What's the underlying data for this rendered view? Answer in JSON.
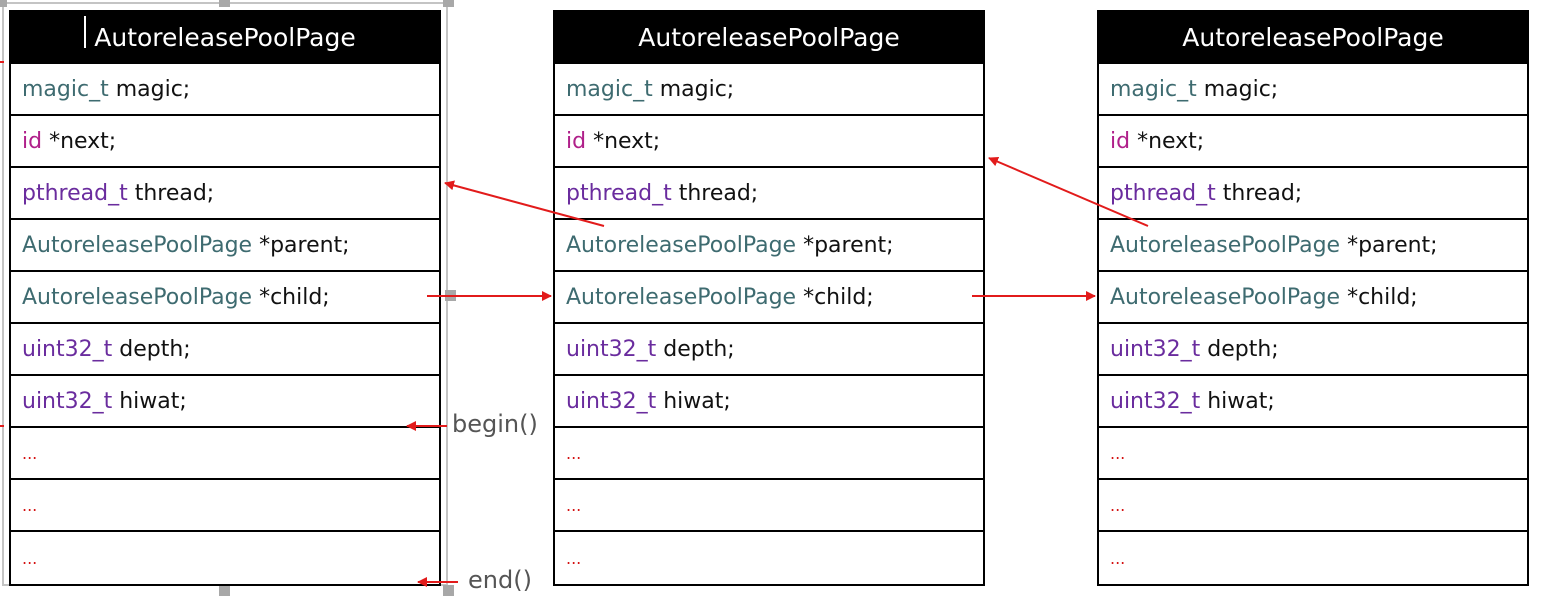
{
  "colors": {
    "teal_type": "#3e6b70",
    "magenta_type": "#b0208a",
    "purple_type": "#6a2c9e",
    "ellipsis": "#d41111",
    "arrow": "#e21b1b"
  },
  "pages": [
    {
      "title": "AutoreleasePoolPage",
      "rows": [
        {
          "type": "magic_t",
          "rest": " magic;",
          "color": "teal"
        },
        {
          "type": "id",
          "rest": " *next;",
          "color": "magenta"
        },
        {
          "type": "pthread_t",
          "rest": " thread;",
          "color": "purple"
        },
        {
          "type": "AutoreleasePoolPage",
          "rest": " *parent;",
          "color": "teal"
        },
        {
          "type": "AutoreleasePoolPage",
          "rest": " *child;",
          "color": "teal"
        },
        {
          "type": "uint32_t",
          "rest": " depth;",
          "color": "purple"
        },
        {
          "type": "uint32_t",
          "rest": " hiwat;",
          "color": "purple"
        },
        {
          "type": "...",
          "rest": "",
          "color": "ellipsis"
        },
        {
          "type": "...",
          "rest": "",
          "color": "ellipsis"
        },
        {
          "type": "...",
          "rest": "",
          "color": "ellipsis"
        }
      ]
    },
    {
      "title": "AutoreleasePoolPage",
      "rows": [
        {
          "type": "magic_t",
          "rest": " magic;",
          "color": "teal"
        },
        {
          "type": "id",
          "rest": " *next;",
          "color": "magenta"
        },
        {
          "type": "pthread_t",
          "rest": " thread;",
          "color": "purple"
        },
        {
          "type": "AutoreleasePoolPage",
          "rest": " *parent;",
          "color": "teal"
        },
        {
          "type": "AutoreleasePoolPage",
          "rest": " *child;",
          "color": "teal"
        },
        {
          "type": "uint32_t",
          "rest": " depth;",
          "color": "purple"
        },
        {
          "type": "uint32_t",
          "rest": " hiwat;",
          "color": "purple"
        },
        {
          "type": "...",
          "rest": "",
          "color": "ellipsis"
        },
        {
          "type": "...",
          "rest": "",
          "color": "ellipsis"
        },
        {
          "type": "...",
          "rest": "",
          "color": "ellipsis"
        }
      ]
    },
    {
      "title": "AutoreleasePoolPage",
      "rows": [
        {
          "type": "magic_t",
          "rest": " magic;",
          "color": "teal"
        },
        {
          "type": "id",
          "rest": " *next;",
          "color": "magenta"
        },
        {
          "type": "pthread_t",
          "rest": " thread;",
          "color": "purple"
        },
        {
          "type": "AutoreleasePoolPage",
          "rest": " *parent;",
          "color": "teal"
        },
        {
          "type": "AutoreleasePoolPage",
          "rest": " *child;",
          "color": "teal"
        },
        {
          "type": "uint32_t",
          "rest": " depth;",
          "color": "purple"
        },
        {
          "type": "uint32_t",
          "rest": " hiwat;",
          "color": "purple"
        },
        {
          "type": "...",
          "rest": "",
          "color": "ellipsis"
        },
        {
          "type": "...",
          "rest": "",
          "color": "ellipsis"
        },
        {
          "type": "...",
          "rest": "",
          "color": "ellipsis"
        }
      ]
    }
  ],
  "labels": {
    "begin": "begin()",
    "end": "end()"
  },
  "connectors": [
    {
      "from": "page-2.parent",
      "to": "page-1.thread"
    },
    {
      "from": "page-3.parent",
      "to": "page-2.next"
    },
    {
      "from": "page-1.child",
      "to": "page-2.child"
    },
    {
      "from": "page-2.child",
      "to": "page-3.child"
    },
    {
      "from": "begin-label",
      "to": "page-1.first-ellipsis"
    },
    {
      "from": "end-label",
      "to": "page-1.bottom"
    }
  ]
}
